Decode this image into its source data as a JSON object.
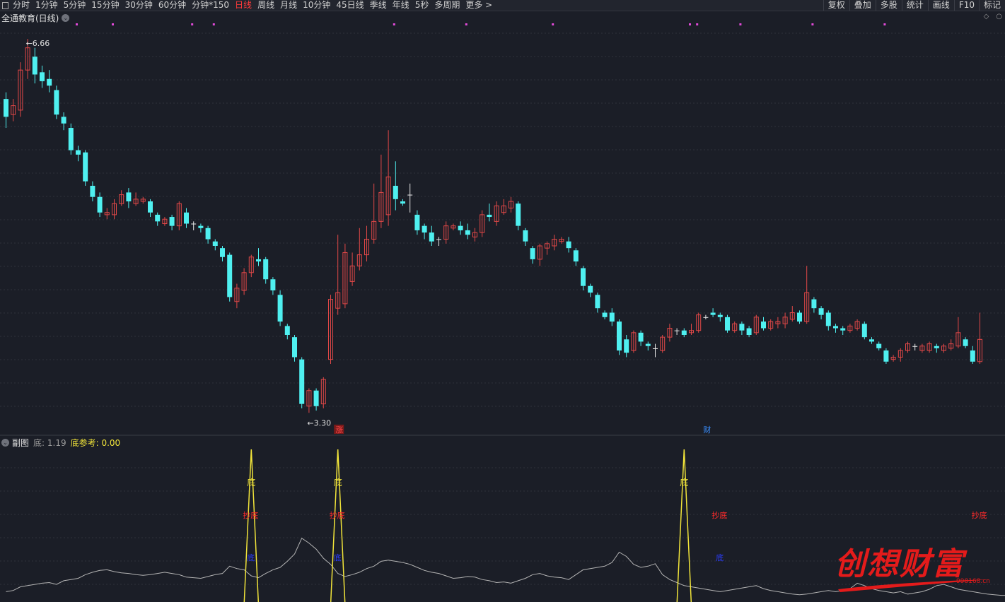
{
  "toolbar": {
    "periods": [
      {
        "label": "分时",
        "active": false
      },
      {
        "label": "1分钟",
        "active": false
      },
      {
        "label": "5分钟",
        "active": false
      },
      {
        "label": "15分钟",
        "active": false
      },
      {
        "label": "30分钟",
        "active": false
      },
      {
        "label": "60分钟",
        "active": false
      },
      {
        "label": "分钟*150",
        "active": false
      },
      {
        "label": "日线",
        "active": true
      },
      {
        "label": "周线",
        "active": false
      },
      {
        "label": "月线",
        "active": false
      },
      {
        "label": "10分钟",
        "active": false
      },
      {
        "label": "45日线",
        "active": false
      },
      {
        "label": "季线",
        "active": false
      },
      {
        "label": "年线",
        "active": false
      },
      {
        "label": "5秒",
        "active": false
      },
      {
        "label": "多周期",
        "active": false
      },
      {
        "label": "更多 >",
        "active": false
      }
    ],
    "right": [
      "复权",
      "叠加",
      "多股",
      "统计",
      "画线",
      "F10",
      "标记"
    ]
  },
  "main": {
    "title": "全通教育(日线)",
    "high_label": "6.66",
    "low_label": "3.30",
    "markers": [
      {
        "text": "涨",
        "index": 46,
        "color": "#ff4a4a"
      },
      {
        "text": "财",
        "index": 97,
        "color": "#3a8fff"
      }
    ]
  },
  "sub": {
    "name": "副图",
    "indicator1": "底: 1.19",
    "indicator2": "底参考: 0.00",
    "signals": [
      {
        "index": 34,
        "di": "底",
        "chaodi": "抄底",
        "blue": "底"
      },
      {
        "index": 46,
        "di": "底",
        "chaodi": "抄底",
        "blue": "底"
      },
      {
        "index": 94,
        "di": "底",
        "chaodi": "",
        "blue": ""
      },
      {
        "index": 99,
        "di": "",
        "chaodi": "抄底",
        "blue": "底"
      },
      {
        "index": 135,
        "di": "",
        "chaodi": "抄底",
        "blue": ""
      }
    ]
  },
  "watermark": {
    "text": "创想财富",
    "url": "998168.cn"
  },
  "colors": {
    "up": "#e34848",
    "down": "#4ff0f0",
    "yellow": "#f1e43a",
    "white_line": "#b4b4b4"
  },
  "chart_data": {
    "type": "candlestick",
    "title": "全通教育(日线)",
    "ylim": [
      3.2,
      6.8
    ],
    "candles": [
      [
        6.12,
        5.96,
        6.18,
        5.86
      ],
      [
        5.98,
        6.06,
        6.12,
        5.92
      ],
      [
        6.02,
        6.38,
        6.45,
        5.96
      ],
      [
        6.38,
        6.58,
        6.66,
        6.3
      ],
      [
        6.5,
        6.34,
        6.58,
        6.26
      ],
      [
        6.36,
        6.28,
        6.42,
        6.22
      ],
      [
        6.3,
        6.24,
        6.38,
        6.18
      ],
      [
        6.2,
        5.98,
        6.24,
        5.94
      ],
      [
        5.96,
        5.9,
        6.0,
        5.84
      ],
      [
        5.86,
        5.66,
        5.9,
        5.62
      ],
      [
        5.66,
        5.62,
        5.7,
        5.56
      ],
      [
        5.64,
        5.38,
        5.66,
        5.34
      ],
      [
        5.34,
        5.24,
        5.38,
        5.2
      ],
      [
        5.24,
        5.1,
        5.28,
        5.06
      ],
      [
        5.08,
        5.1,
        5.14,
        5.04
      ],
      [
        5.08,
        5.18,
        5.22,
        5.04
      ],
      [
        5.18,
        5.26,
        5.3,
        5.16
      ],
      [
        5.28,
        5.2,
        5.32,
        5.14
      ],
      [
        5.18,
        5.22,
        5.28,
        5.16
      ],
      [
        5.2,
        5.22,
        5.24,
        5.18
      ],
      [
        5.2,
        5.1,
        5.22,
        5.06
      ],
      [
        5.08,
        5.02,
        5.1,
        4.98
      ],
      [
        5.0,
        5.04,
        5.06,
        4.98
      ],
      [
        5.06,
        4.98,
        5.08,
        4.94
      ],
      [
        4.98,
        5.18,
        5.2,
        4.94
      ],
      [
        5.1,
        5.0,
        5.14,
        4.96
      ],
      [
        5.0,
        5.0,
        5.02,
        4.94
      ],
      [
        4.98,
        4.96,
        5.0,
        4.92
      ],
      [
        4.96,
        4.86,
        4.98,
        4.82
      ],
      [
        4.84,
        4.8,
        4.86,
        4.76
      ],
      [
        4.78,
        4.7,
        4.8,
        4.66
      ],
      [
        4.72,
        4.34,
        4.74,
        4.3
      ],
      [
        4.3,
        4.42,
        4.46,
        4.24
      ],
      [
        4.4,
        4.56,
        4.6,
        4.36
      ],
      [
        4.56,
        4.7,
        4.72,
        4.52
      ],
      [
        4.68,
        4.66,
        4.78,
        4.62
      ],
      [
        4.68,
        4.5,
        4.7,
        4.46
      ],
      [
        4.5,
        4.4,
        4.52,
        4.36
      ],
      [
        4.36,
        4.12,
        4.4,
        4.08
      ],
      [
        4.08,
        4.0,
        4.1,
        3.96
      ],
      [
        3.98,
        3.8,
        4.0,
        3.76
      ],
      [
        3.78,
        3.38,
        3.8,
        3.34
      ],
      [
        3.36,
        3.5,
        3.52,
        3.3
      ],
      [
        3.5,
        3.36,
        3.52,
        3.32
      ],
      [
        3.38,
        3.6,
        3.62,
        3.34
      ],
      [
        3.78,
        4.32,
        4.36,
        3.74
      ],
      [
        4.24,
        4.38,
        4.9,
        4.18
      ],
      [
        4.28,
        4.74,
        4.82,
        4.24
      ],
      [
        4.48,
        4.62,
        4.74,
        4.44
      ],
      [
        4.62,
        4.72,
        4.96,
        4.58
      ],
      [
        4.72,
        4.86,
        4.98,
        4.66
      ],
      [
        4.86,
        5.02,
        5.36,
        4.82
      ],
      [
        5.02,
        5.28,
        5.62,
        4.96
      ],
      [
        5.08,
        5.42,
        5.84,
        4.98
      ],
      [
        5.34,
        5.22,
        5.56,
        5.12
      ],
      [
        5.2,
        5.18,
        5.22,
        5.16
      ],
      [
        5.26,
        5.26,
        5.36,
        5.1
      ],
      [
        5.08,
        4.94,
        5.12,
        4.9
      ],
      [
        4.98,
        4.92,
        5.0,
        4.86
      ],
      [
        4.92,
        4.84,
        4.98,
        4.8
      ],
      [
        4.86,
        4.86,
        4.88,
        4.8
      ],
      [
        4.86,
        4.98,
        5.02,
        4.82
      ],
      [
        4.96,
        4.98,
        5.0,
        4.94
      ],
      [
        4.98,
        4.94,
        5.02,
        4.9
      ],
      [
        4.94,
        4.9,
        5.0,
        4.86
      ],
      [
        4.88,
        4.92,
        4.96,
        4.84
      ],
      [
        4.92,
        5.08,
        5.12,
        4.88
      ],
      [
        5.08,
        5.06,
        5.18,
        5.02
      ],
      [
        5.02,
        5.16,
        5.2,
        4.98
      ],
      [
        5.1,
        5.16,
        5.22,
        5.08
      ],
      [
        5.14,
        5.2,
        5.24,
        5.1
      ],
      [
        5.18,
        4.98,
        5.2,
        4.94
      ],
      [
        4.94,
        4.84,
        4.96,
        4.8
      ],
      [
        4.78,
        4.68,
        4.8,
        4.64
      ],
      [
        4.68,
        4.8,
        4.82,
        4.62
      ],
      [
        4.78,
        4.82,
        4.84,
        4.72
      ],
      [
        4.8,
        4.86,
        4.9,
        4.76
      ],
      [
        4.84,
        4.86,
        4.88,
        4.82
      ],
      [
        4.84,
        4.78,
        4.88,
        4.74
      ],
      [
        4.76,
        4.66,
        4.78,
        4.62
      ],
      [
        4.6,
        4.44,
        4.62,
        4.4
      ],
      [
        4.44,
        4.38,
        4.46,
        4.34
      ],
      [
        4.36,
        4.24,
        4.38,
        4.2
      ],
      [
        4.2,
        4.16,
        4.22,
        4.14
      ],
      [
        4.2,
        4.12,
        4.24,
        4.08
      ],
      [
        4.12,
        3.86,
        4.14,
        3.82
      ],
      [
        3.96,
        3.84,
        4.0,
        3.8
      ],
      [
        3.86,
        4.02,
        4.04,
        3.84
      ],
      [
        4.02,
        3.94,
        4.04,
        3.9
      ],
      [
        3.92,
        3.9,
        3.94,
        3.86
      ],
      [
        3.88,
        3.88,
        3.92,
        3.8
      ],
      [
        3.86,
        3.98,
        4.0,
        3.84
      ],
      [
        3.98,
        4.06,
        4.1,
        3.94
      ],
      [
        4.04,
        4.04,
        4.06,
        4.0
      ],
      [
        4.04,
        4.0,
        4.06,
        3.98
      ],
      [
        4.02,
        4.04,
        4.1,
        4.0
      ],
      [
        4.04,
        4.18,
        4.2,
        4.02
      ],
      [
        4.16,
        4.16,
        4.18,
        4.14
      ],
      [
        4.2,
        4.18,
        4.24,
        4.16
      ],
      [
        4.18,
        4.16,
        4.2,
        4.12
      ],
      [
        4.16,
        4.04,
        4.18,
        4.02
      ],
      [
        4.04,
        4.1,
        4.12,
        4.02
      ],
      [
        4.1,
        4.04,
        4.12,
        4.0
      ],
      [
        4.06,
        4.0,
        4.08,
        3.98
      ],
      [
        4.02,
        4.16,
        4.18,
        4.0
      ],
      [
        4.12,
        4.06,
        4.16,
        4.04
      ],
      [
        4.06,
        4.12,
        4.14,
        4.04
      ],
      [
        4.1,
        4.12,
        4.16,
        4.06
      ],
      [
        4.1,
        4.16,
        4.2,
        4.06
      ],
      [
        4.14,
        4.2,
        4.26,
        4.12
      ],
      [
        4.2,
        4.12,
        4.22,
        4.1
      ],
      [
        4.12,
        4.38,
        4.62,
        4.1
      ],
      [
        4.32,
        4.24,
        4.34,
        4.2
      ],
      [
        4.24,
        4.18,
        4.26,
        4.14
      ],
      [
        4.2,
        4.08,
        4.22,
        4.04
      ],
      [
        4.08,
        4.06,
        4.1,
        4.02
      ],
      [
        4.06,
        4.04,
        4.08,
        4.0
      ],
      [
        4.04,
        4.08,
        4.1,
        4.02
      ],
      [
        4.06,
        4.12,
        4.14,
        4.04
      ],
      [
        4.1,
        3.98,
        4.12,
        3.96
      ],
      [
        3.96,
        3.94,
        3.98,
        3.92
      ],
      [
        3.92,
        3.88,
        3.94,
        3.86
      ],
      [
        3.86,
        3.76,
        3.88,
        3.74
      ],
      [
        3.78,
        3.8,
        3.82,
        3.76
      ],
      [
        3.8,
        3.86,
        3.88,
        3.76
      ],
      [
        3.86,
        3.92,
        3.94,
        3.84
      ],
      [
        3.9,
        3.9,
        3.92,
        3.86
      ],
      [
        3.86,
        3.9,
        3.92,
        3.84
      ],
      [
        3.86,
        3.92,
        3.94,
        3.84
      ],
      [
        3.9,
        3.88,
        3.92,
        3.84
      ],
      [
        3.86,
        3.9,
        3.92,
        3.84
      ],
      [
        3.88,
        3.92,
        3.96,
        3.86
      ],
      [
        3.9,
        4.02,
        4.16,
        3.88
      ],
      [
        3.96,
        3.9,
        3.98,
        3.88
      ],
      [
        3.86,
        3.76,
        3.9,
        3.74
      ],
      [
        3.76,
        3.96,
        4.2,
        3.74
      ]
    ],
    "sub_line": [
      0.1,
      0.12,
      0.18,
      0.2,
      0.22,
      0.24,
      0.25,
      0.22,
      0.28,
      0.3,
      0.32,
      0.38,
      0.42,
      0.45,
      0.46,
      0.43,
      0.41,
      0.4,
      0.38,
      0.37,
      0.38,
      0.4,
      0.42,
      0.4,
      0.38,
      0.34,
      0.33,
      0.32,
      0.35,
      0.38,
      0.4,
      0.52,
      0.48,
      0.46,
      0.36,
      0.33,
      0.4,
      0.46,
      0.5,
      0.6,
      0.72,
      0.98,
      0.9,
      0.8,
      0.65,
      0.55,
      0.4,
      0.35,
      0.38,
      0.42,
      0.48,
      0.52,
      0.6,
      0.62,
      0.6,
      0.58,
      0.55,
      0.5,
      0.45,
      0.42,
      0.4,
      0.36,
      0.32,
      0.33,
      0.35,
      0.34,
      0.3,
      0.28,
      0.25,
      0.26,
      0.24,
      0.28,
      0.32,
      0.38,
      0.4,
      0.36,
      0.34,
      0.33,
      0.3,
      0.38,
      0.46,
      0.48,
      0.5,
      0.52,
      0.58,
      0.75,
      0.68,
      0.55,
      0.5,
      0.52,
      0.56,
      0.38,
      0.3,
      0.25,
      0.2,
      0.18,
      0.16,
      0.14,
      0.12,
      0.1,
      0.12,
      0.14,
      0.16,
      0.18,
      0.2,
      0.15,
      0.12,
      0.1,
      0.08,
      0.06,
      0.05,
      0.06,
      0.08,
      0.1,
      0.12,
      0.1,
      0.12,
      0.15,
      0.24,
      0.2,
      0.15,
      0.12,
      0.1,
      0.08,
      0.1,
      0.06,
      0.08,
      0.1,
      0.14,
      0.2,
      0.22,
      0.18,
      0.14,
      0.12,
      0.1,
      0.08,
      0.06,
      0.05,
      0.04,
      0.04,
      0.1
    ]
  }
}
